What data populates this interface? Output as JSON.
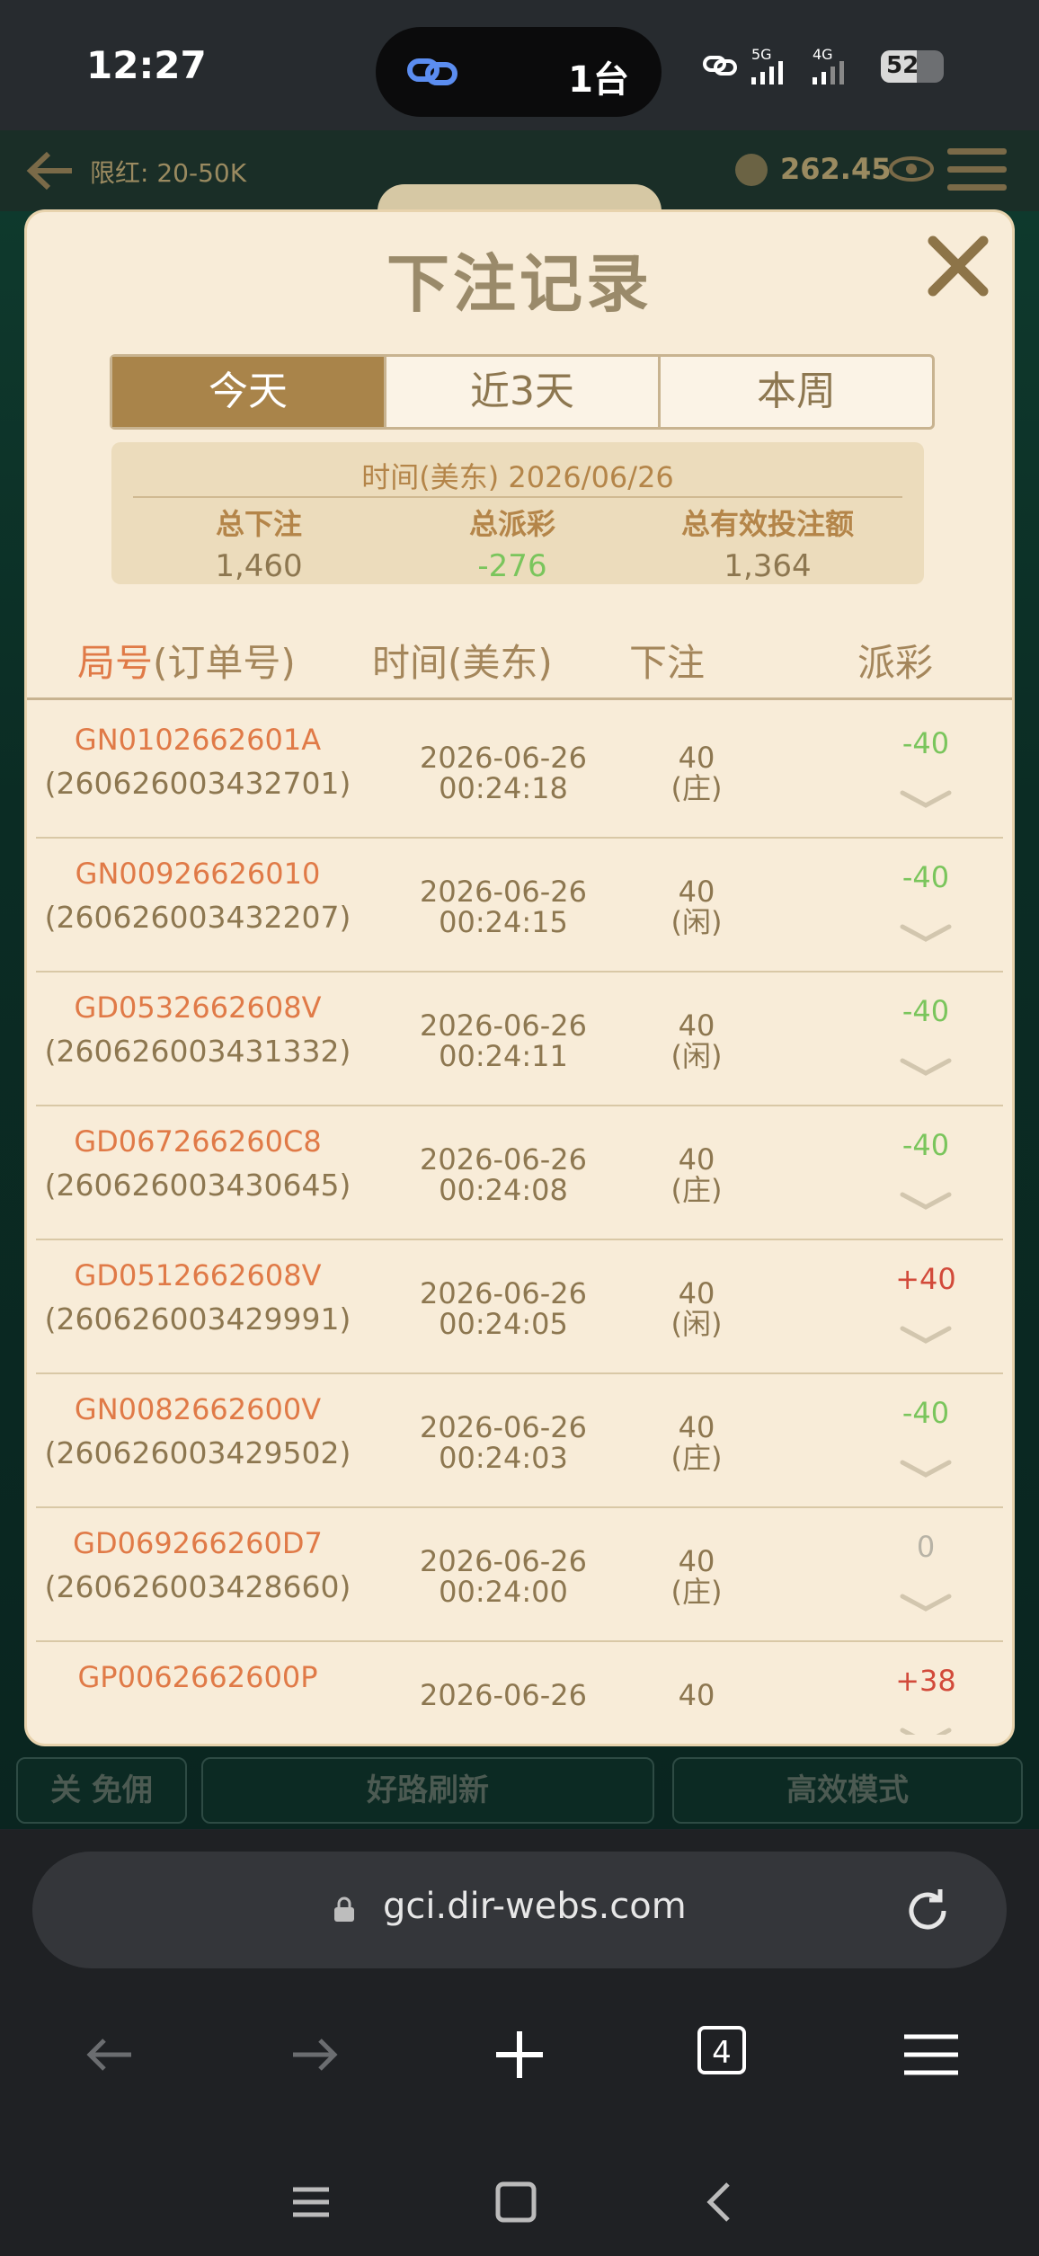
{
  "status_bar": {
    "time": "12:27",
    "island_text": "1台",
    "battery": "52"
  },
  "game": {
    "limit_label": "限红: 20-50K",
    "balance": "262.45",
    "bottom_buttons": {
      "left": "关 免佣",
      "middle": "好路刷新",
      "right": "高效模式"
    }
  },
  "modal": {
    "title": "下注记录",
    "tabs": [
      "今天",
      "近3天",
      "本周"
    ],
    "active_tab": "今天",
    "summary": {
      "date_line": "时间(美东) 2026/06/26",
      "total_bet_label": "总下注",
      "total_bet": "1,460",
      "total_payout_label": "总派彩",
      "total_payout": "-276",
      "valid_bet_label": "总有效投注额",
      "valid_bet": "1,364"
    },
    "columns": {
      "round_a": "局号",
      "round_b": "(订单号)",
      "time": "时间(美东)",
      "bet": "下注",
      "payout": "派彩"
    },
    "rows": [
      {
        "id": "GN0102662601A",
        "order": "(260626003432701)",
        "date": "2026-06-26",
        "time": "00:24:18",
        "amount": "40",
        "side": "(庄)",
        "payout": "-40",
        "kind": "loss"
      },
      {
        "id": "GN00926626010",
        "order": "(260626003432207)",
        "date": "2026-06-26",
        "time": "00:24:15",
        "amount": "40",
        "side": "(闲)",
        "payout": "-40",
        "kind": "loss"
      },
      {
        "id": "GD0532662608V",
        "order": "(260626003431332)",
        "date": "2026-06-26",
        "time": "00:24:11",
        "amount": "40",
        "side": "(闲)",
        "payout": "-40",
        "kind": "loss"
      },
      {
        "id": "GD067266260C8",
        "order": "(260626003430645)",
        "date": "2026-06-26",
        "time": "00:24:08",
        "amount": "40",
        "side": "(庄)",
        "payout": "-40",
        "kind": "loss"
      },
      {
        "id": "GD0512662608V",
        "order": "(260626003429991)",
        "date": "2026-06-26",
        "time": "00:24:05",
        "amount": "40",
        "side": "(闲)",
        "payout": "+40",
        "kind": "win"
      },
      {
        "id": "GN0082662600V",
        "order": "(260626003429502)",
        "date": "2026-06-26",
        "time": "00:24:03",
        "amount": "40",
        "side": "(庄)",
        "payout": "-40",
        "kind": "loss"
      },
      {
        "id": "GD069266260D7",
        "order": "(260626003428660)",
        "date": "2026-06-26",
        "time": "00:24:00",
        "amount": "40",
        "side": "(庄)",
        "payout": "0",
        "kind": "tie"
      },
      {
        "id": "GP0062662600P",
        "order": "",
        "date": "2026-06-26",
        "time": "",
        "amount": "40",
        "side": "",
        "payout": "+38",
        "kind": "win"
      }
    ]
  },
  "browser": {
    "url": "gci.dir-webs.com",
    "tab_count": "4"
  },
  "colors": {
    "win": "#d24a3a",
    "loss": "#7ac55c",
    "tie": "#b8b3a6",
    "accent": "#a9844a"
  }
}
